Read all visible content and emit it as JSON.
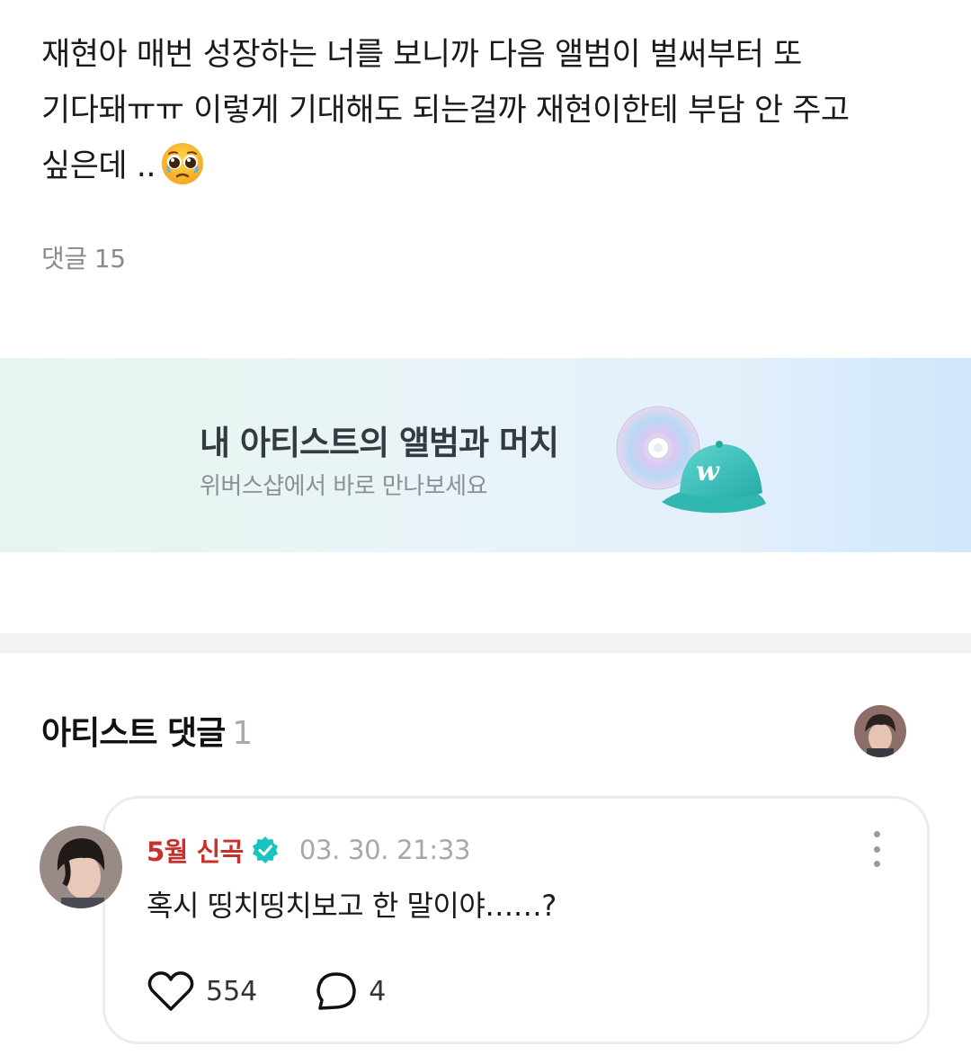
{
  "post": {
    "lines": [
      "재현아 매번 성장하는 너를 보니까 다음 앨범이 벌써부터 또",
      "기다돼ㅠㅠ 이렇게 기대해도 되는걸까 재현이한테 부담 안 주고",
      "싶은데 .."
    ],
    "emoji": "pleading-face-emoji",
    "comment_count_label": "댓글 15"
  },
  "banner": {
    "title": "내 아티스트의 앨범과 머치",
    "subtitle": "위버스샵에서 바로 만나보세요",
    "art": "cd-and-cap-icon",
    "cap_letter": "w",
    "colors": {
      "cap": "#3cc9c2",
      "gradient_start": "#e5f6ee",
      "gradient_end": "#cfe6fb"
    }
  },
  "artist_comments": {
    "title": "아티스트 댓글",
    "count": "1",
    "avatar": "artist-avatar"
  },
  "comment": {
    "author": "5월 신곡",
    "verified_icon": "verified-badge-icon",
    "timestamp": "03. 30. 21:33",
    "text": "혹시 띵치띵치보고 한 말이야……?",
    "likes": "554",
    "replies": "4",
    "colors": {
      "author": "#c8312b",
      "verified": "#19c4c0"
    }
  }
}
